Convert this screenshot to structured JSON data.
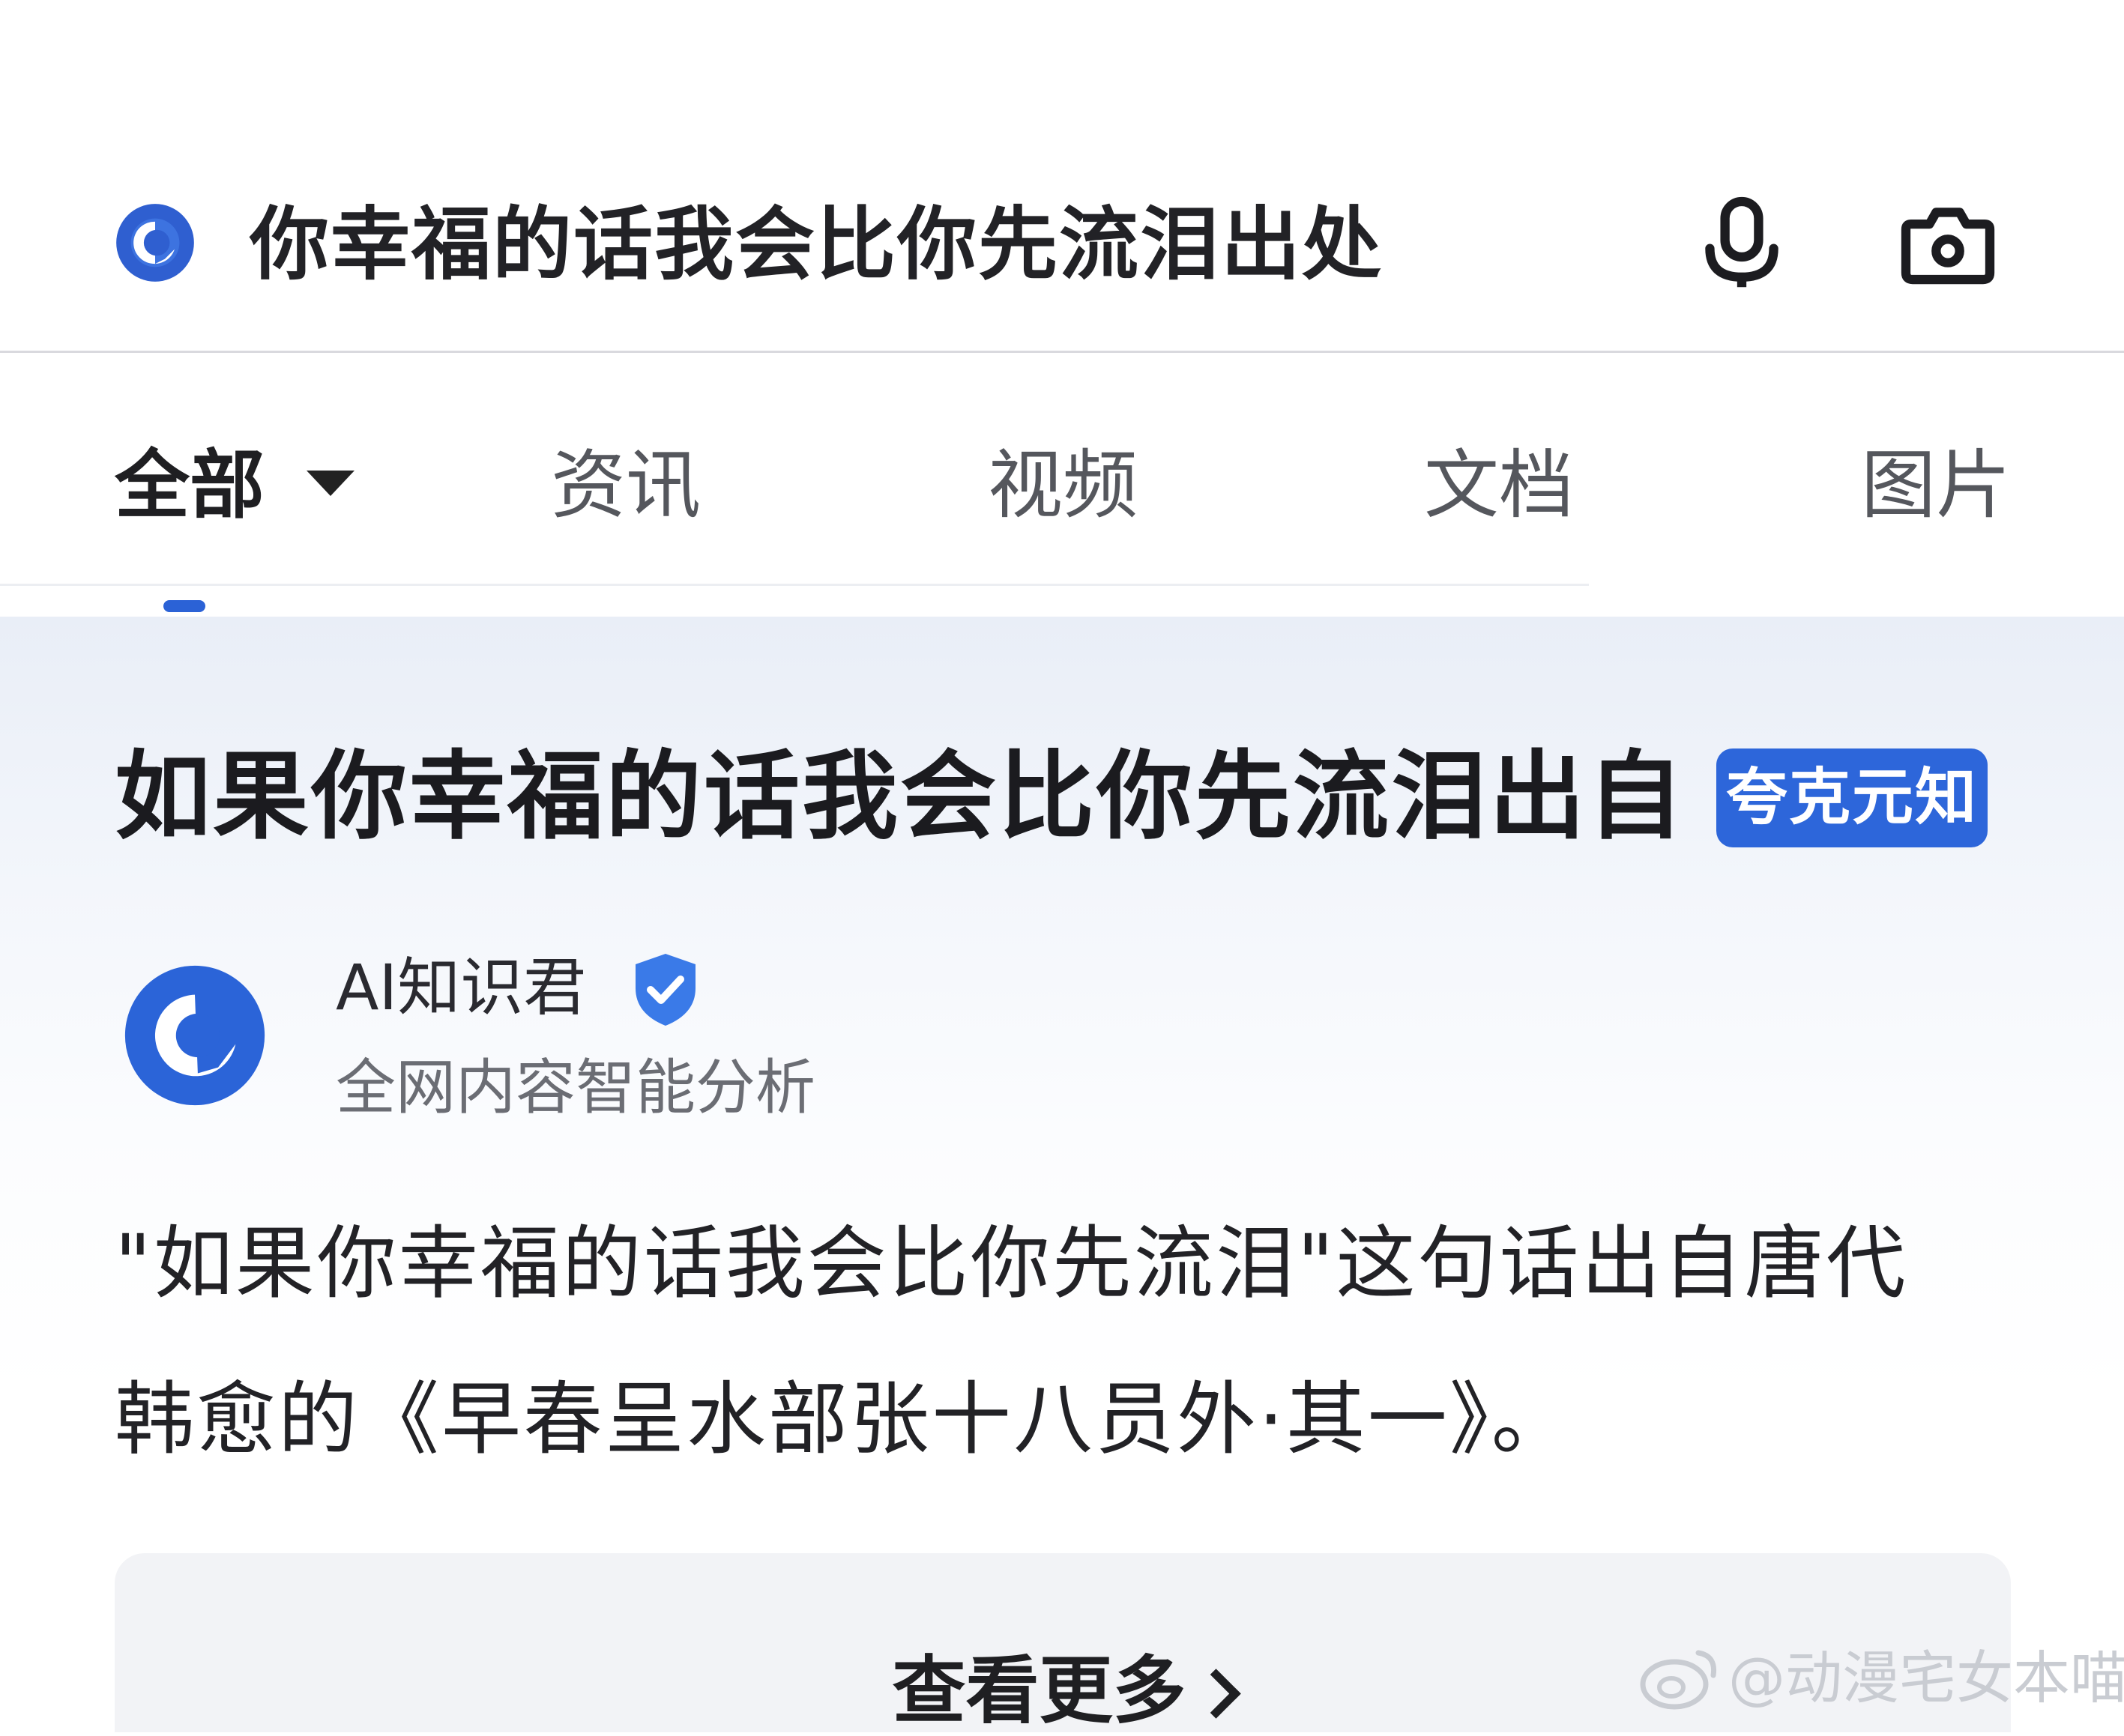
{
  "search": {
    "query": "你幸福的话我会比你先流泪出处",
    "icons": [
      "quark-logo-icon",
      "microphone-icon",
      "camera-icon"
    ]
  },
  "tabs": [
    {
      "label": "全部",
      "active": true
    },
    {
      "label": "资讯",
      "active": false
    },
    {
      "label": "视频",
      "active": false
    },
    {
      "label": "文档",
      "active": false
    },
    {
      "label": "图片",
      "active": false
    }
  ],
  "result": {
    "title": "如果你幸福的话我会比你先流泪出自",
    "badge": "夸克元知",
    "source": {
      "name": "AI知识君",
      "subtitle": "全网内容智能分析",
      "verified": true
    },
    "answer_line1": "\"如果你幸福的话我会比你先流泪\"这句话出自唐代",
    "answer_line2": "韩愈的《早春呈水部张十八员外·其一》。",
    "more_label": "查看更多"
  },
  "watermark": "@动漫宅女本喵",
  "colors": {
    "brand_blue": "#2d66da",
    "tab_indicator": "#2b62d6",
    "text_primary": "#1f1f22",
    "text_secondary": "#6b6d74"
  }
}
